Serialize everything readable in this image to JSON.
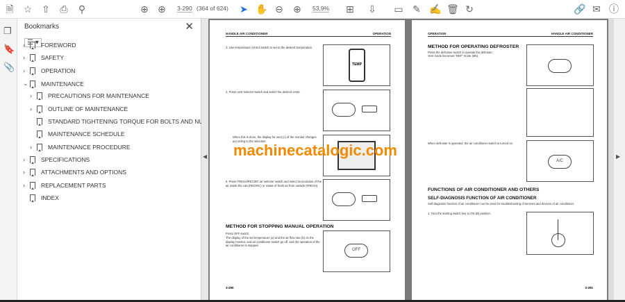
{
  "toolbar": {
    "page_input": "3-290",
    "page_count": "(364 of 624)",
    "zoom": "53,9%"
  },
  "bookmarks": {
    "title": "Bookmarks",
    "items": [
      {
        "label": "FOREWORD"
      },
      {
        "label": "SAFETY"
      },
      {
        "label": "OPERATION"
      },
      {
        "label": "MAINTENANCE"
      },
      {
        "label": "PRECAUTIONS FOR MAINTENANCE"
      },
      {
        "label": "OUTLINE OF MAINTENANCE"
      },
      {
        "label": "STANDARD TIGHTENING TORQUE FOR BOLTS AND NUTS"
      },
      {
        "label": "MAINTENANCE SCHEDULE"
      },
      {
        "label": "MAINTENANCE PROCEDURE"
      },
      {
        "label": "SPECIFICATIONS"
      },
      {
        "label": "ATTACHMENTS AND OPTIONS"
      },
      {
        "label": "REPLACEMENT PARTS"
      },
      {
        "label": "INDEX"
      }
    ]
  },
  "left_page": {
    "header_left": "HANDLE AIR CONDITIONER",
    "header_right": "OPERATION",
    "step3": "3.   Use temperature control switch to set to the desired temperature.",
    "step4": "4.   Press vent selector switch and select the desired vents.",
    "step4b": "When this is done, the display for vent (c) of the monitor changes according to the selection.",
    "step5": "5.   Press FRESH/RECIRC air selector switch and select recirculation of the air inside the cab (RECIRC) or intake of fresh air from outside (FRESH).",
    "heading": "METHOD FOR STOPPING MANUAL OPERATION",
    "stop1": "Press OFF switch.",
    "stop2": "The display of the set temperature (a) and the air flow rate (b) on the display monitor, and air conditioner switch go off, and the operation of the air conditioner is stopped.",
    "temp_label": "TEMP",
    "off_label": "OFF",
    "page_number": "3-290"
  },
  "right_page": {
    "header_left": "OPERATION",
    "header_right": "HANDLE AIR CONDITIONER",
    "heading1": "METHOD FOR OPERATING DEFROSTER",
    "def1": "Press the defroster switch to operate the defroster.",
    "def2": "Vent mode becomes \"DEF\" mode (M5).",
    "def3": "When defroster is operated, the air conditioner switch is turned on.",
    "heading2": "FUNCTIONS OF AIR CONDITIONER AND OTHERS",
    "heading3": "SELF-DIAGNOSIS FUNCTION OF AIR CONDITIONER",
    "diag1": "Self-diagnosis function of air conditioner can be used for troubleshooting of sensors and devices of air conditioner.",
    "diag2": "1.   Turn the starting switch key to ON (B) position.",
    "ac_label": "A/C",
    "page_number": "3-291"
  },
  "watermark": "machinecatalogic.com"
}
